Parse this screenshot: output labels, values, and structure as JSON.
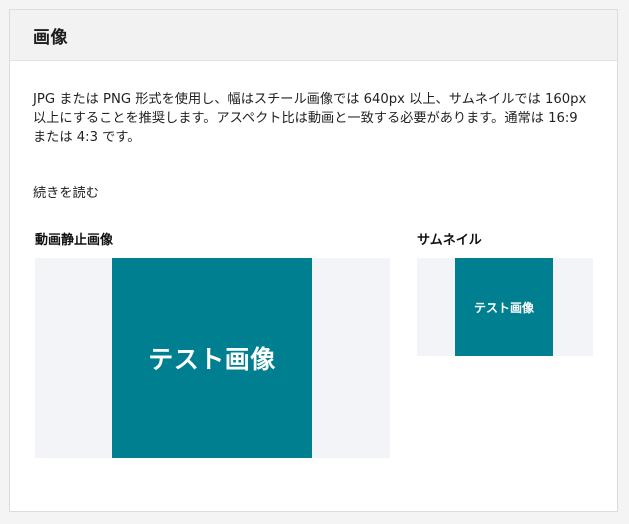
{
  "panel": {
    "title": "画像",
    "description": "JPG または PNG 形式を使用し、幅はスチール画像では 640px 以上、サムネイルでは 160px 以上にすることを推奨します。アスペクト比は動画と一致する必要があります。通常は 16:9 または 4:3 です。",
    "read_more": "続きを読む"
  },
  "still_image": {
    "label": "動画静止画像",
    "image_text": "テスト画像"
  },
  "thumbnail": {
    "label": "サムネイル",
    "image_text": "テスト画像"
  },
  "colors": {
    "image_fill": "#007f91",
    "frame_background": "#f3f4f8"
  }
}
